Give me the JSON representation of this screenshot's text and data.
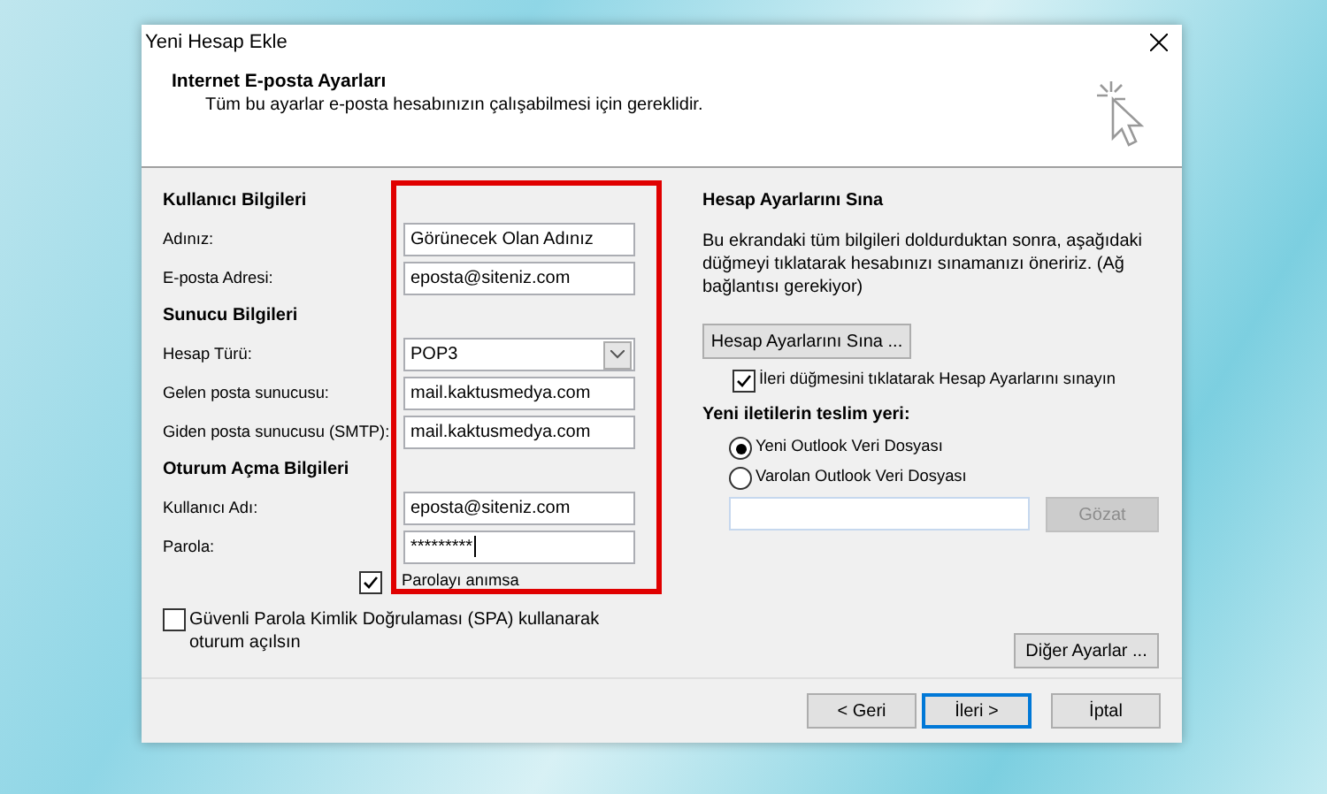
{
  "window": {
    "title": "Yeni Hesap Ekle"
  },
  "header": {
    "title": "Internet E-posta Ayarları",
    "subtitle": "Tüm bu ayarlar e-posta hesabınızın çalışabilmesi için gereklidir."
  },
  "sections": [
    {
      "heading": "Kullanıcı Bilgileri",
      "fields": [
        {
          "label": "Adınız:",
          "value": "Görünecek Olan Adınız",
          "kind": "text"
        },
        {
          "label": "E-posta Adresi:",
          "value": "eposta@siteniz.com",
          "kind": "text"
        }
      ]
    },
    {
      "heading": "Sunucu Bilgileri",
      "fields": [
        {
          "label": "Hesap Türü:",
          "value": "POP3",
          "kind": "select"
        },
        {
          "label": "Gelen posta sunucusu:",
          "value": "mail.kaktusmedya.com",
          "kind": "text"
        },
        {
          "label": "Giden posta sunucusu (SMTP):",
          "value": "mail.kaktusmedya.com",
          "kind": "text"
        }
      ]
    },
    {
      "heading": "Oturum Açma Bilgileri",
      "fields": [
        {
          "label": "Kullanıcı Adı:",
          "value": "eposta@siteniz.com",
          "kind": "text"
        },
        {
          "label": "Parola:",
          "value": "*********",
          "kind": "password"
        }
      ]
    }
  ],
  "remember_password": {
    "label": "Parolayı anımsa",
    "checked": true
  },
  "spa": {
    "label": "Güvenli Parola Kimlik Doğrulaması (SPA) kullanarak oturum açılsın",
    "checked": false
  },
  "test": {
    "heading": "Hesap Ayarlarını Sına",
    "description": "Bu ekrandaki tüm bilgileri doldurduktan sonra, aşağıdaki düğmeyi tıklatarak hesabınızı sınamanızı öneririz. (Ağ bağlantısı gerekiyor)",
    "button": "Hesap Ayarlarını Sına ...",
    "auto_test": {
      "label": "İleri düğmesini tıklatarak Hesap Ayarlarını sınayın",
      "checked": true
    }
  },
  "delivery": {
    "heading": "Yeni iletilerin teslim yeri:",
    "options": [
      {
        "label": "Yeni Outlook Veri Dosyası",
        "selected": true
      },
      {
        "label": "Varolan Outlook Veri Dosyası",
        "selected": false
      }
    ],
    "browse_button": {
      "label": "Gözat",
      "disabled": true
    }
  },
  "more_settings": "Diğer Ayarlar ...",
  "buttons": [
    {
      "label": "< Geri",
      "default": false
    },
    {
      "label": "İleri >",
      "default": true
    },
    {
      "label": "İptal",
      "default": false
    }
  ]
}
